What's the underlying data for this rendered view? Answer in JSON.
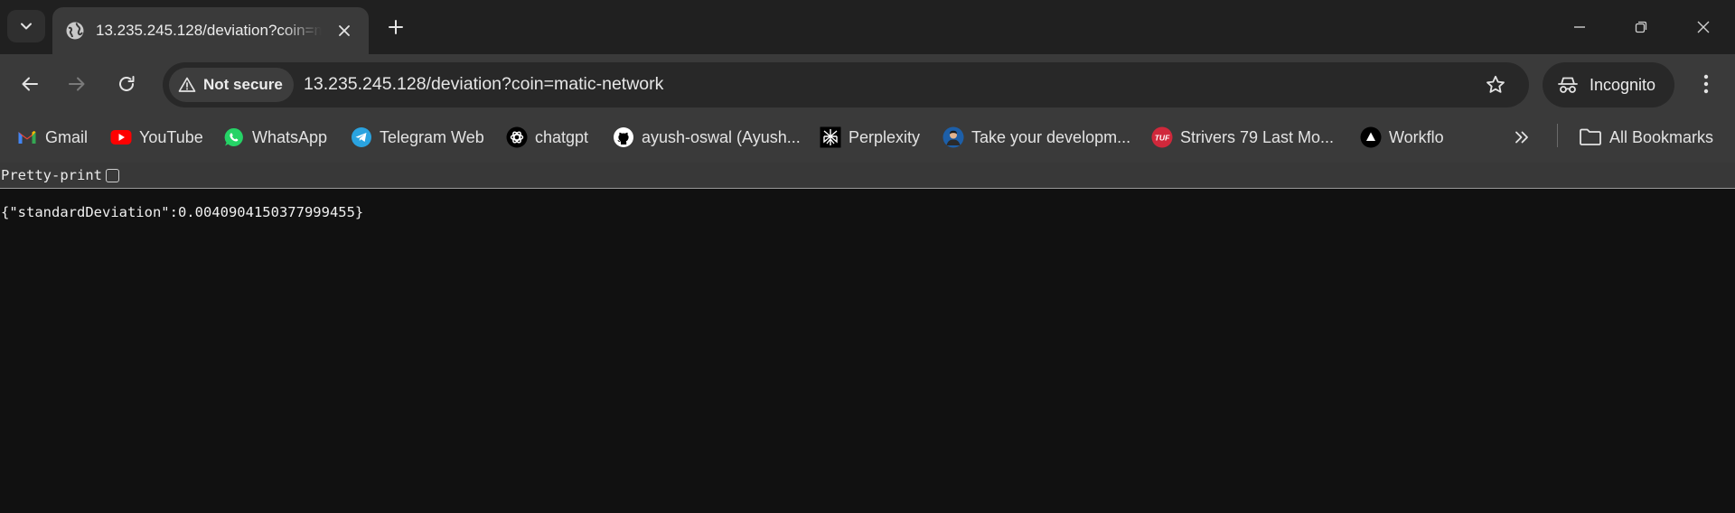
{
  "tab": {
    "title": "13.235.245.128/deviation?coin=matic-network",
    "favicon": "globe-icon"
  },
  "toolbar": {
    "security_label": "Not secure",
    "url": "13.235.245.128/deviation?coin=matic-network",
    "profile_label": "Incognito"
  },
  "bookmarks": {
    "items": [
      {
        "label": "Gmail",
        "icon": "gmail-icon"
      },
      {
        "label": "YouTube",
        "icon": "youtube-icon"
      },
      {
        "label": "WhatsApp",
        "icon": "whatsapp-icon"
      },
      {
        "label": "Telegram Web",
        "icon": "telegram-icon"
      },
      {
        "label": "chatgpt",
        "icon": "chatgpt-icon"
      },
      {
        "label": "ayush-oswal (Ayush...",
        "icon": "github-icon"
      },
      {
        "label": "Perplexity",
        "icon": "perplexity-icon"
      },
      {
        "label": "Take your developm...",
        "icon": "avatar-icon"
      },
      {
        "label": "Strivers 79 Last Mo...",
        "icon": "tuf-icon"
      },
      {
        "label": "Workflo",
        "icon": "workflo-icon"
      }
    ],
    "all_bookmarks_label": "All Bookmarks",
    "tuf_badge": "TUF"
  },
  "page": {
    "pretty_print_label": "Pretty-print",
    "pretty_print_checked": false,
    "json_text": "{\"standardDeviation\":0.0040904150377999455}"
  },
  "colors": {
    "background": "#111111",
    "chrome_frame": "#202020",
    "toolbar": "#3a3a3a",
    "omnibox": "#282828",
    "youtube_red": "#ff0000",
    "whatsapp_green": "#25d366",
    "telegram_blue": "#2aa3e0",
    "tuf_red": "#d0283b"
  }
}
